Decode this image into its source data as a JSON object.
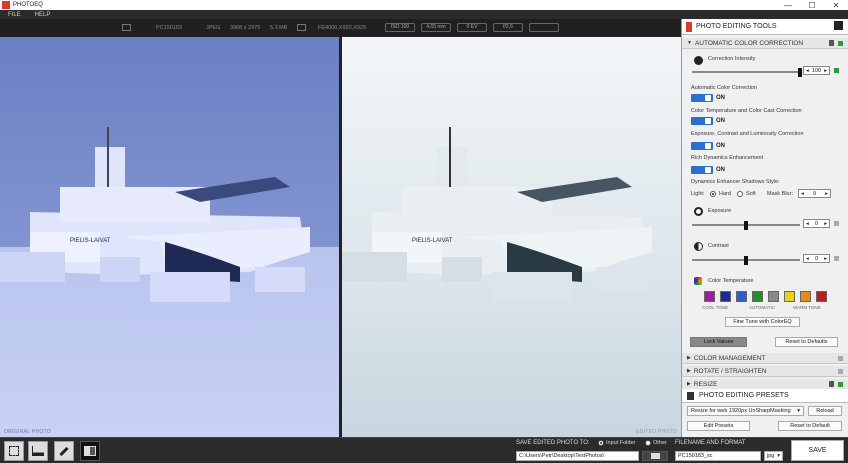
{
  "window": {
    "title": "PHOTOEQ",
    "minimize": "—",
    "maximize": "☐",
    "close": "✕"
  },
  "menu": {
    "file": "FILE",
    "help": "HELP"
  },
  "info": {
    "filename": "PC150183",
    "format": "JPEG",
    "dimensions": "3968 x 2976",
    "size": "5,3 MB",
    "camera": "FE4000,X920,X925",
    "iso": "ISO 100",
    "focal": "4,65 mm",
    "ev": "0 EV",
    "aperture": "f/2,6"
  },
  "photos": {
    "original_label": "ORIGINAL PHOTO",
    "edited_label": "EDITED PHOTO"
  },
  "panel": {
    "title": "PHOTO EDITING TOOLS",
    "auto_section": "AUTOMATIC COLOR CORRECTION",
    "correction_intensity": {
      "label": "Correction Intensity",
      "value": "100",
      "level_percent": 100
    },
    "auto_color": {
      "label": "Automatic Color Correction",
      "state": "ON"
    },
    "temp_cast": {
      "label": "Color Temperature and Color Cast Correction",
      "state": "ON"
    },
    "exposure_corr": {
      "label": "Exposure, Contrast and Luminosity Correction",
      "state": "ON"
    },
    "rich_dyn": {
      "label": "Rich Dynamics Enhancement",
      "state": "ON"
    },
    "shadows": {
      "label": "Dynamics Enhancer Shadows Style:",
      "light": "Light:",
      "hard": "Hard",
      "soft": "Soft",
      "mask_blur": "Mask Blur:",
      "mask_value": "9"
    },
    "exposure": {
      "label": "Exposure",
      "value": "0",
      "level_percent": 50
    },
    "contrast": {
      "label": "Contrast",
      "value": "0",
      "level_percent": 50
    },
    "color_temp": {
      "label": "Color Temperature",
      "cool": "COOL TONE",
      "auto": "AUTOMATIC",
      "warm": "WARM TONE",
      "swatches": [
        "#9a1f9a",
        "#1a2a9a",
        "#2a5fc8",
        "#2a8a2a",
        "#8a8a8a",
        "#e8d21a",
        "#e88a1a",
        "#b82020"
      ]
    },
    "fine_tune": "Fine Tune with ColorEQ",
    "lock_values": "Lock Values",
    "reset_defaults": "Reset to Defaults",
    "sections": [
      "COLOR MANAGEMENT",
      "ROTATE / STRAIGHTEN",
      "RESIZE"
    ],
    "presets_title": "PHOTO EDITING PRESETS",
    "preset_selected": "Resize for web 1920px UnSharpMasking",
    "reload": "Reload",
    "edit_presets": "Edit Presets",
    "reset_default": "Reset to Default"
  },
  "save": {
    "title": "SAVE EDITED PHOTO TO:",
    "input_folder": "Input Folder",
    "other": "Other",
    "path": "C:\\Users\\Petr\\Desktop\\TestPhotos\\",
    "filename_title": "FILENAME AND FORMAT",
    "filename": "PC150183_sc",
    "ext": "jpg",
    "save_button": "SAVE"
  },
  "colors": {
    "accent": "#2d6fd0",
    "brand": "#d9382b"
  }
}
